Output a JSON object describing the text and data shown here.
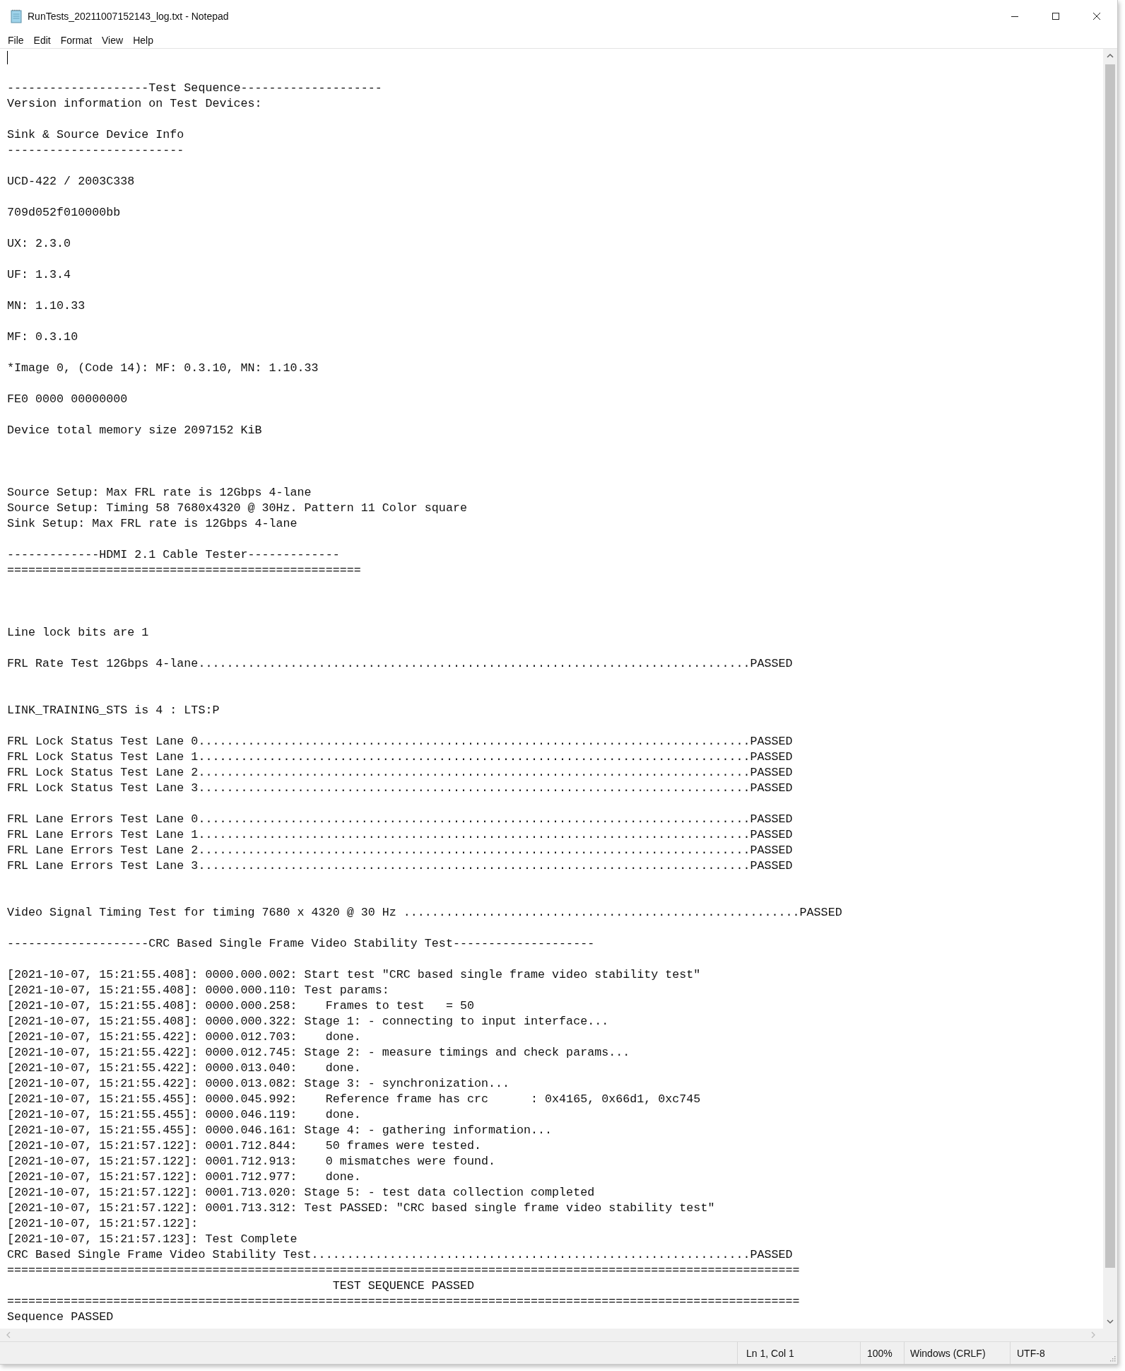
{
  "window": {
    "title": "RunTests_20211007152143_log.txt - Notepad"
  },
  "menu": [
    "File",
    "Edit",
    "Format",
    "View",
    "Help"
  ],
  "editor": {
    "caret": true,
    "lines": [
      {
        "kind": "blank"
      },
      {
        "kind": "blank"
      },
      {
        "kind": "text",
        "text": "--------------------Test Sequence--------------------"
      },
      {
        "kind": "text",
        "text": "Version information on Test Devices:"
      },
      {
        "kind": "blank"
      },
      {
        "kind": "text",
        "text": "Sink & Source Device Info"
      },
      {
        "kind": "text",
        "text": "-------------------------"
      },
      {
        "kind": "blank"
      },
      {
        "kind": "text",
        "text": "UCD-422 / 2003C338"
      },
      {
        "kind": "blank"
      },
      {
        "kind": "text",
        "text": "709d052f010000bb"
      },
      {
        "kind": "blank"
      },
      {
        "kind": "text",
        "text": "UX: 2.3.0"
      },
      {
        "kind": "blank"
      },
      {
        "kind": "text",
        "text": "UF: 1.3.4"
      },
      {
        "kind": "blank"
      },
      {
        "kind": "text",
        "text": "MN: 1.10.33"
      },
      {
        "kind": "blank"
      },
      {
        "kind": "text",
        "text": "MF: 0.3.10"
      },
      {
        "kind": "blank"
      },
      {
        "kind": "text",
        "text": "*Image 0, (Code 14): MF: 0.3.10, MN: 1.10.33"
      },
      {
        "kind": "blank"
      },
      {
        "kind": "text",
        "text": "FE0 0000 00000000"
      },
      {
        "kind": "blank"
      },
      {
        "kind": "text",
        "text": "Device total memory size 2097152 KiB"
      },
      {
        "kind": "blank"
      },
      {
        "kind": "blank"
      },
      {
        "kind": "blank"
      },
      {
        "kind": "text",
        "text": "Source Setup: Max FRL rate is 12Gbps 4-lane"
      },
      {
        "kind": "text",
        "text": "Source Setup: Timing 58 7680x4320 @ 30Hz. Pattern 11 Color square"
      },
      {
        "kind": "text",
        "text": "Sink Setup: Max FRL rate is 12Gbps 4-lane"
      },
      {
        "kind": "blank"
      },
      {
        "kind": "text",
        "text": "-------------HDMI 2.1 Cable Tester-------------"
      },
      {
        "kind": "text",
        "text": "=================================================="
      },
      {
        "kind": "blank"
      },
      {
        "kind": "blank"
      },
      {
        "kind": "blank"
      },
      {
        "kind": "text",
        "text": "Line lock bits are 1"
      },
      {
        "kind": "blank"
      },
      {
        "kind": "text",
        "text": "FRL Rate Test 12Gbps 4-lane..............................................................................PASSED"
      },
      {
        "kind": "blank"
      },
      {
        "kind": "blank"
      },
      {
        "kind": "text",
        "text": "LINK_TRAINING_STS is 4 : LTS:P"
      },
      {
        "kind": "blank"
      },
      {
        "kind": "text",
        "text": "FRL Lock Status Test Lane 0..............................................................................PASSED"
      },
      {
        "kind": "text",
        "text": "FRL Lock Status Test Lane 1..............................................................................PASSED"
      },
      {
        "kind": "text",
        "text": "FRL Lock Status Test Lane 2..............................................................................PASSED"
      },
      {
        "kind": "text",
        "text": "FRL Lock Status Test Lane 3..............................................................................PASSED"
      },
      {
        "kind": "blank"
      },
      {
        "kind": "text",
        "text": "FRL Lane Errors Test Lane 0..............................................................................PASSED"
      },
      {
        "kind": "text",
        "text": "FRL Lane Errors Test Lane 1..............................................................................PASSED"
      },
      {
        "kind": "text",
        "text": "FRL Lane Errors Test Lane 2..............................................................................PASSED"
      },
      {
        "kind": "text",
        "text": "FRL Lane Errors Test Lane 3..............................................................................PASSED"
      },
      {
        "kind": "blank"
      },
      {
        "kind": "blank"
      },
      {
        "kind": "text",
        "text": "Video Signal Timing Test for timing 7680 x 4320 @ 30 Hz ........................................................PASSED"
      },
      {
        "kind": "blank"
      },
      {
        "kind": "text",
        "text": "--------------------CRC Based Single Frame Video Stability Test--------------------"
      },
      {
        "kind": "blank"
      },
      {
        "kind": "text",
        "text": "[2021-10-07, 15:21:55.408]: 0000.000.002: Start test \"CRC based single frame video stability test\""
      },
      {
        "kind": "text",
        "text": "[2021-10-07, 15:21:55.408]: 0000.000.110: Test params:"
      },
      {
        "kind": "text",
        "text": "[2021-10-07, 15:21:55.408]: 0000.000.258:    Frames to test   = 50"
      },
      {
        "kind": "text",
        "text": "[2021-10-07, 15:21:55.408]: 0000.000.322: Stage 1: - connecting to input interface..."
      },
      {
        "kind": "text",
        "text": "[2021-10-07, 15:21:55.422]: 0000.012.703:    done."
      },
      {
        "kind": "text",
        "text": "[2021-10-07, 15:21:55.422]: 0000.012.745: Stage 2: - measure timings and check params..."
      },
      {
        "kind": "text",
        "text": "[2021-10-07, 15:21:55.422]: 0000.013.040:    done."
      },
      {
        "kind": "text",
        "text": "[2021-10-07, 15:21:55.422]: 0000.013.082: Stage 3: - synchronization..."
      },
      {
        "kind": "text",
        "text": "[2021-10-07, 15:21:55.455]: 0000.045.992:    Reference frame has crc      : 0x4165, 0x66d1, 0xc745"
      },
      {
        "kind": "text",
        "text": "[2021-10-07, 15:21:55.455]: 0000.046.119:    done."
      },
      {
        "kind": "text",
        "text": "[2021-10-07, 15:21:55.455]: 0000.046.161: Stage 4: - gathering information..."
      },
      {
        "kind": "text",
        "text": "[2021-10-07, 15:21:57.122]: 0001.712.844:    50 frames were tested."
      },
      {
        "kind": "text",
        "text": "[2021-10-07, 15:21:57.122]: 0001.712.913:    0 mismatches were found."
      },
      {
        "kind": "text",
        "text": "[2021-10-07, 15:21:57.122]: 0001.712.977:    done."
      },
      {
        "kind": "text",
        "text": "[2021-10-07, 15:21:57.122]: 0001.713.020: Stage 5: - test data collection completed"
      },
      {
        "kind": "text",
        "text": "[2021-10-07, 15:21:57.122]: 0001.713.312: Test PASSED: \"CRC based single frame video stability test\""
      },
      {
        "kind": "text",
        "text": "[2021-10-07, 15:21:57.122]:"
      },
      {
        "kind": "text",
        "text": "[2021-10-07, 15:21:57.123]: Test Complete"
      },
      {
        "kind": "text",
        "text": "CRC Based Single Frame Video Stability Test..............................................................PASSED"
      },
      {
        "kind": "text",
        "text": "================================================================================================================"
      },
      {
        "kind": "text",
        "text": "                                              TEST SEQUENCE PASSED"
      },
      {
        "kind": "text",
        "text": "================================================================================================================"
      },
      {
        "kind": "text",
        "text": "Sequence PASSED"
      }
    ]
  },
  "status_bar": {
    "position": "Ln 1, Col 1",
    "zoom": "100%",
    "line_ending": "Windows (CRLF)",
    "encoding": "UTF-8"
  }
}
